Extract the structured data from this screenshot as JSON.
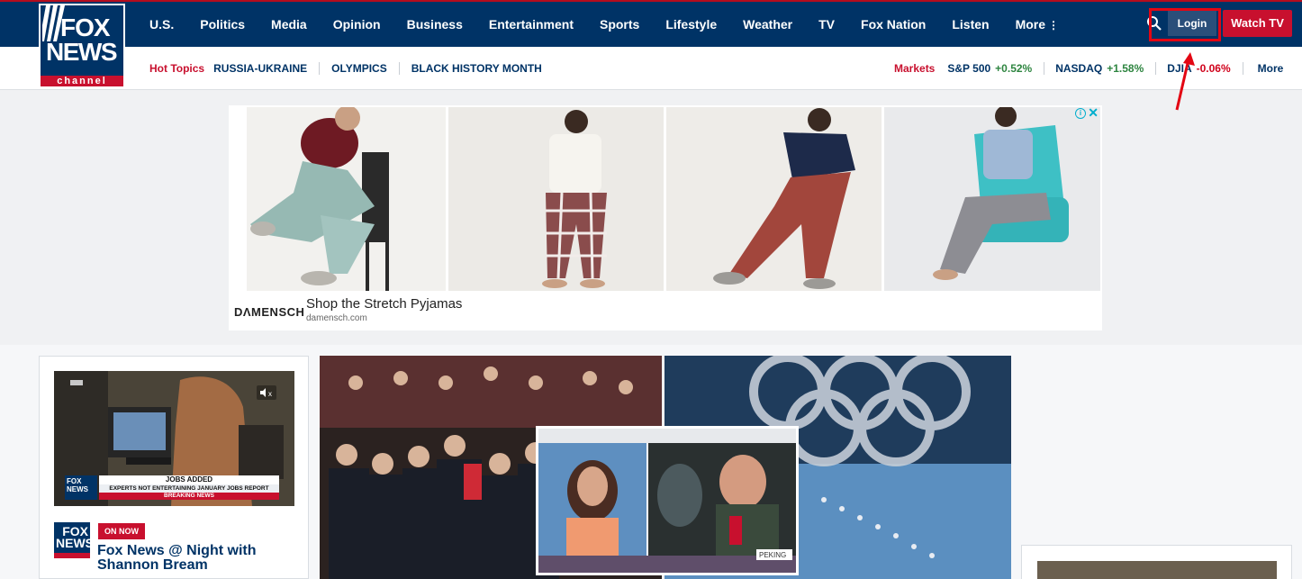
{
  "header": {
    "logo_text": {
      "line1": "FOX",
      "line2": "NEWS",
      "line3": "channel"
    },
    "nav": [
      {
        "label": "U.S."
      },
      {
        "label": "Politics"
      },
      {
        "label": "Media"
      },
      {
        "label": "Opinion"
      },
      {
        "label": "Business"
      },
      {
        "label": "Entertainment"
      },
      {
        "label": "Sports"
      },
      {
        "label": "Lifestyle"
      },
      {
        "label": "Weather"
      },
      {
        "label": "TV"
      },
      {
        "label": "Fox Nation"
      },
      {
        "label": "Listen"
      },
      {
        "label": "More"
      }
    ],
    "more_icon": "vertical-ellipsis-icon",
    "search_icon": "search-icon",
    "login_label": "Login",
    "watch_tv_label": "Watch TV"
  },
  "subnav": {
    "hot_topics_label": "Hot Topics",
    "hot_topics": [
      "RUSSIA-UKRAINE",
      "OLYMPICS",
      "BLACK HISTORY MONTH"
    ],
    "markets_label": "Markets",
    "markets": [
      {
        "name": "S&P 500",
        "change": "+0.52%",
        "direction": "up"
      },
      {
        "name": "NASDAQ",
        "change": "+1.58%",
        "direction": "up"
      },
      {
        "name": "DJIA",
        "change": "-0.06%",
        "direction": "down"
      }
    ],
    "markets_more": "More"
  },
  "ad": {
    "brand": "DΛMENSCH",
    "title": "Shop the Stretch Pyjamas",
    "url": "damensch.com",
    "info_icon": "info-icon",
    "close_icon": "close-icon"
  },
  "video_card": {
    "chyron_top": "JOBS ADDED",
    "chyron_mid": "EXPERTS NOT ENTERTAINING JANUARY JOBS REPORT",
    "chyron_bottom": "BREAKING NEWS",
    "badge": "ON NOW",
    "title": "Fox News @ Night with Shannon Bream",
    "mute_icon": "mute-icon"
  },
  "main_image": {
    "inset_label": "PEKING"
  },
  "colors": {
    "navy": "#003366",
    "red": "#c8102e",
    "up": "#2e8540",
    "down": "#d0021b"
  }
}
